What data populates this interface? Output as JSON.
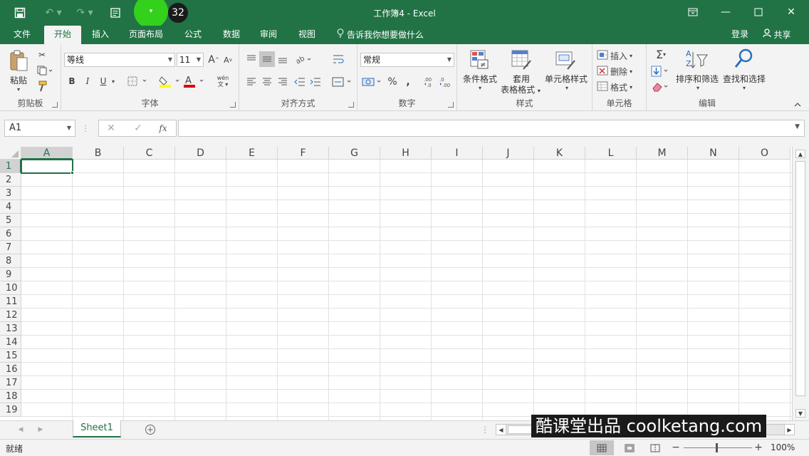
{
  "window": {
    "title": "工作簿4 - Excel",
    "badge_count": "32"
  },
  "tabs": [
    {
      "label": "文件"
    },
    {
      "label": "开始"
    },
    {
      "label": "插入"
    },
    {
      "label": "页面布局"
    },
    {
      "label": "公式"
    },
    {
      "label": "数据"
    },
    {
      "label": "审阅"
    },
    {
      "label": "视图"
    }
  ],
  "tell_me": "告诉我你想要做什么",
  "account": {
    "login": "登录",
    "share": "共享"
  },
  "ribbon": {
    "clipboard": {
      "label": "剪贴板",
      "paste": "粘贴"
    },
    "font": {
      "label": "字体",
      "font_name": "等线",
      "font_size": "11",
      "bold": "B",
      "italic": "I",
      "underline": "U",
      "grow": "A",
      "shrink": "A",
      "phonetic": "wén"
    },
    "alignment": {
      "label": "对齐方式"
    },
    "number": {
      "label": "数字",
      "format": "常规",
      "percent": "%",
      "comma": ","
    },
    "styles": {
      "label": "样式",
      "conditional": "条件格式",
      "table_line1": "套用",
      "table_line2": "表格格式",
      "cell_styles": "单元格样式"
    },
    "cells": {
      "label": "单元格",
      "insert": "插入",
      "delete": "删除",
      "format": "格式"
    },
    "editing": {
      "label": "编辑",
      "sort_filter": "排序和筛选",
      "find_select": "查找和选择"
    }
  },
  "formula_bar": {
    "name_box": "A1",
    "fx": "fx",
    "value": ""
  },
  "columns": [
    "A",
    "B",
    "C",
    "D",
    "E",
    "F",
    "G",
    "H",
    "I",
    "J",
    "K",
    "L",
    "M",
    "N",
    "O"
  ],
  "rows": [
    "1",
    "2",
    "3",
    "4",
    "5",
    "6",
    "7",
    "8",
    "9",
    "10",
    "11",
    "12",
    "13",
    "14",
    "15",
    "16",
    "17",
    "18",
    "19"
  ],
  "sheets": [
    {
      "name": "Sheet1"
    }
  ],
  "status": {
    "ready": "就绪",
    "zoom": "100%",
    "minus": "−",
    "plus": "+"
  },
  "watermark": "酷课堂出品 coolketang.com",
  "colors": {
    "accent": "#217346",
    "ribbon_bg": "#f3f3f3",
    "cursor": "#33d11c"
  }
}
